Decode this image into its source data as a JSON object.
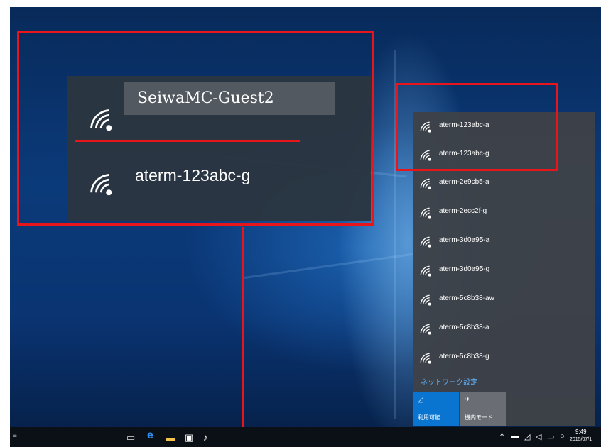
{
  "zoom_popup": {
    "network_1": "SeiwaMC-Guest2",
    "network_2": "aterm-123abc-g"
  },
  "flyout": {
    "networks": [
      "aterm-123abc-a",
      "aterm-123abc-g",
      "aterm-2e9cb5-a",
      "aterm-2ecc2f-g",
      "aterm-3d0a95-a",
      "aterm-3d0a95-g",
      "aterm-5c8b38-aw",
      "aterm-5c8b38-a",
      "aterm-5c8b38-g"
    ],
    "settings_link": "ネットワーク設定",
    "wifi_tile_label": "利用可能",
    "airplane_tile_label": "機内モード"
  },
  "taskbar": {
    "time": "9:49",
    "date": "2015/07/1"
  },
  "colors": {
    "highlight_red": "#e8161b",
    "tile_active": "#0a74d1",
    "link_blue": "#5fb5ff"
  },
  "icons": [
    "wifi-icon",
    "search-icon",
    "task-view-icon",
    "edge-icon",
    "file-explorer-icon",
    "store-icon",
    "chevron-up-icon",
    "notification-icon"
  ]
}
